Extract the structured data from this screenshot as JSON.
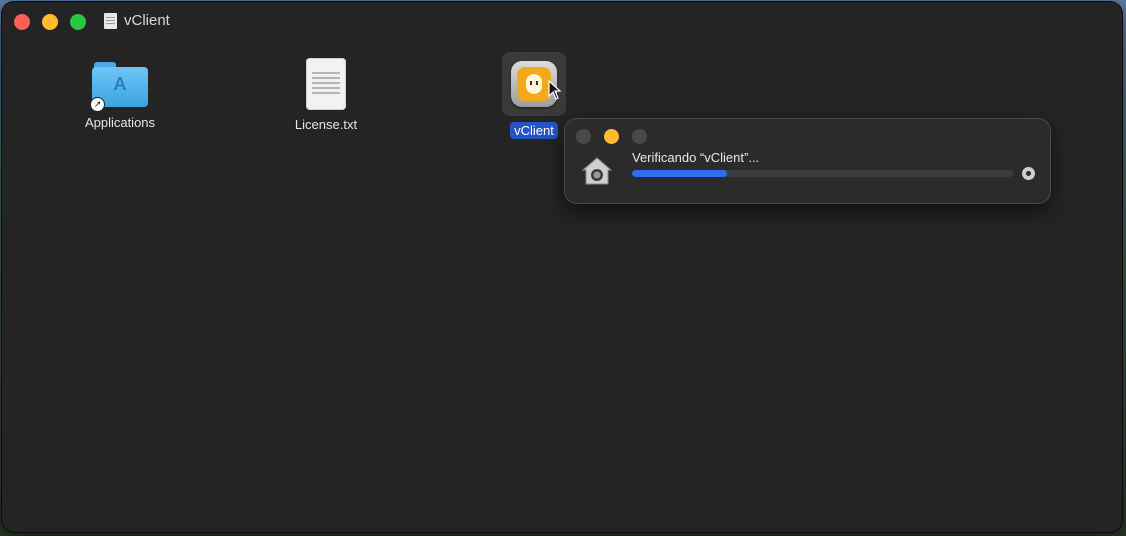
{
  "window": {
    "title": "vClient"
  },
  "items": [
    {
      "label": "Applications",
      "icon": "applications-folder-icon"
    },
    {
      "label": "License.txt",
      "icon": "text-file-icon"
    },
    {
      "label": "vClient",
      "icon": "vclient-app-icon"
    }
  ],
  "verify": {
    "message": "Verificando “vClient”...",
    "progress": 0.25
  },
  "colors": {
    "window_bg": "#242424",
    "selection": "#2454c6",
    "progress": "#2f6cf1"
  }
}
